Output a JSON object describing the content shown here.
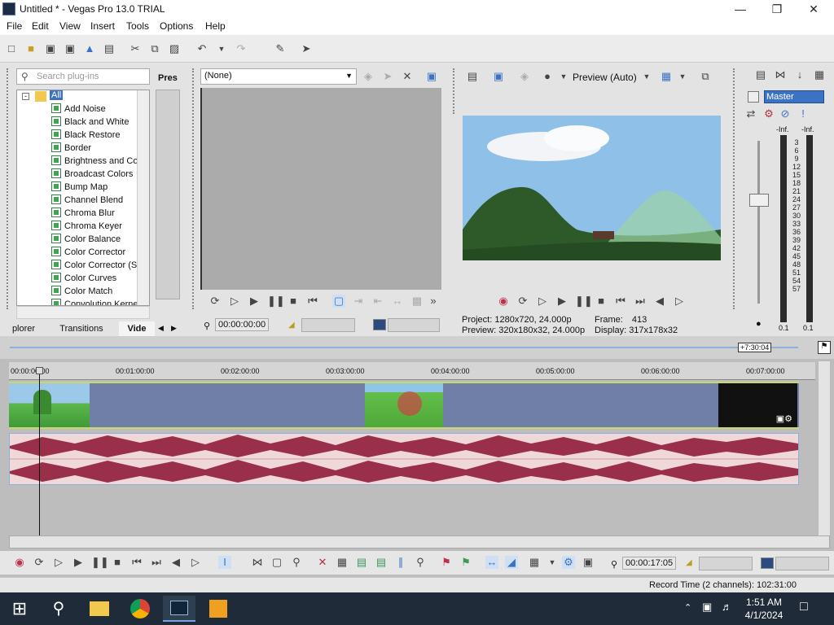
{
  "window": {
    "title": "Untitled * - Vegas Pro 13.0 TRIAL"
  },
  "menu": [
    "File",
    "Edit",
    "View",
    "Insert",
    "Tools",
    "Options",
    "Help"
  ],
  "plugins": {
    "search_placeholder": "Search plug-ins",
    "presets_label": "Pres",
    "root": "All",
    "items": [
      "Add Noise",
      "Black and White",
      "Black Restore",
      "Border",
      "Brightness and Co",
      "Broadcast Colors",
      "Bump Map",
      "Channel Blend",
      "Chroma Blur",
      "Chroma Keyer",
      "Color Balance",
      "Color Corrector",
      "Color Corrector (S",
      "Color Curves",
      "Color Match",
      "Convolution Kerne"
    ],
    "tabs": [
      "plorer",
      "Transitions",
      "Vide"
    ]
  },
  "trimmer": {
    "dropdown": "(None)",
    "time": "00:00:00:00"
  },
  "preview": {
    "mode": "Preview (Auto)",
    "project_label": "Project:",
    "project_value": "1280x720, 24.000p",
    "preview_label": "Preview:",
    "preview_value": "320x180x32, 24.000p",
    "frame_label": "Frame:",
    "frame_value": "413",
    "display_label": "Display:",
    "display_value": "317x178x32"
  },
  "master": {
    "label": "Master",
    "left_inf": "-Inf.",
    "right_inf": "-Inf.",
    "scale": [
      "3",
      "6",
      "9",
      "12",
      "15",
      "18",
      "21",
      "24",
      "27",
      "30",
      "33",
      "36",
      "39",
      "42",
      "45",
      "48",
      "51",
      "54",
      "57"
    ],
    "bottom_left": "0.1",
    "bottom_right": "0.1"
  },
  "timeline": {
    "length_badge": "+7:30:04",
    "ticks": [
      "00:00:00:00",
      "00:01:00:00",
      "00:02:00:00",
      "00:03:00:00",
      "00:04:00:00",
      "00:05:00:00",
      "00:06:00:00",
      "00:07:00:00"
    ],
    "cursor_time": "00:00:17:05"
  },
  "status": {
    "record_time": "Record Time (2 channels): 102:31:00"
  },
  "clock": {
    "time": "1:51 AM",
    "date": "4/1/2024"
  },
  "colors": {
    "accent": "#3b73c4",
    "audio_wave": "#9a2f4a",
    "video_track": "#6f7fa8"
  }
}
